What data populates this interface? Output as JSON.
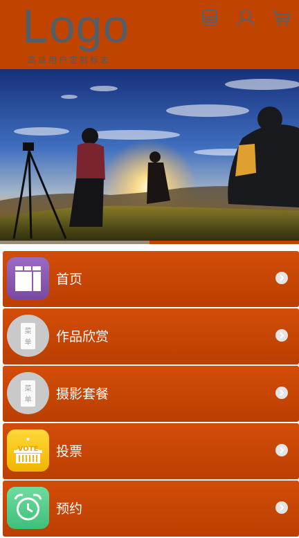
{
  "header": {
    "logo_text": "Logo",
    "logo_subtitle": "高端用户定制标志",
    "icons": [
      "database-icon",
      "user-icon",
      "cart-icon"
    ]
  },
  "banner": {
    "image": "sunset-photographers-photo",
    "slides": 2,
    "active_slide": 2
  },
  "menu": {
    "items": [
      {
        "label": "首页",
        "icon": "home-grid-icon",
        "icon_color": "#8c5bb3"
      },
      {
        "label": "作品欣赏",
        "icon": "menu-card-icon",
        "icon_text": [
          "菜",
          "单"
        ],
        "icon_color": "#c8c8c8"
      },
      {
        "label": "摄影套餐",
        "icon": "menu-card-icon",
        "icon_text": [
          "菜",
          "单"
        ],
        "icon_color": "#c8c8c8"
      },
      {
        "label": "投票",
        "icon": "vote-box-icon",
        "icon_text": [
          "VOTE"
        ],
        "icon_color": "#f5c400"
      },
      {
        "label": "预约",
        "icon": "alarm-clock-icon",
        "icon_color": "#5fcf8f"
      }
    ]
  },
  "colors": {
    "brand": "#c04400",
    "menu_top": "#d24d08",
    "menu_bottom": "#bb3f02",
    "logo": "#555d66"
  }
}
